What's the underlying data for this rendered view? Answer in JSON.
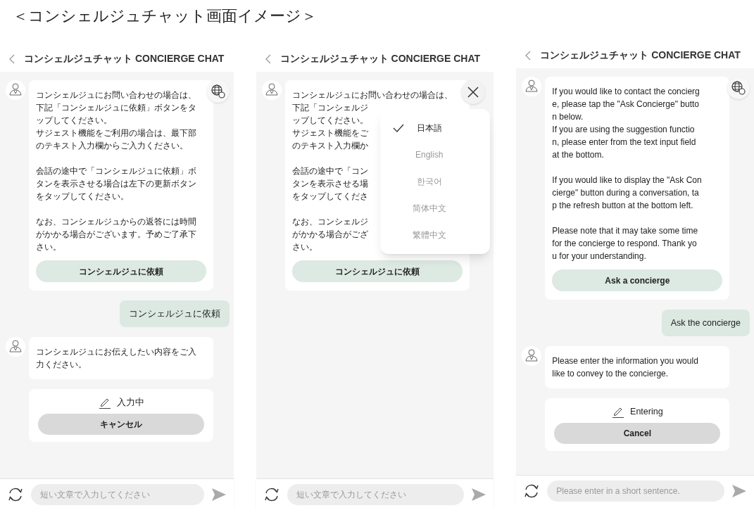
{
  "page_title": "＜コンシェルジュチャット画面イメージ＞",
  "screens": [
    {
      "header": {
        "title": "コンシェルジュチャット CONCIERGE CHAT"
      },
      "corner_button": {
        "kind": "language"
      },
      "messages": [
        {
          "kind": "bot",
          "paragraphs": [
            [
              "コンシェルジュにお問い合わせの場合は、",
              "下記「コンシェルジュに依頼」ボタンをタ",
              "ップしてください。",
              "サジェスト機能をご利用の場合は、最下部",
              "のテキスト入力欄からご入力ください。"
            ],
            [
              "会話の途中で「コンシェルジュに依頼」ボ",
              "タンを表示させる場合は左下の更新ボタン",
              "をタップしてください。"
            ],
            [
              "なお、コンシェルジュからの返答には時間",
              "がかかる場合がございます。予めご了承下",
              "さい。"
            ]
          ],
          "button": "コンシェルジュに依頼"
        },
        {
          "kind": "user",
          "text": "コンシェルジュに依頼"
        },
        {
          "kind": "bot",
          "paragraphs": [
            [
              "コンシェルジュにお伝えしたい内容をご入",
              "力ください。"
            ]
          ]
        },
        {
          "kind": "status",
          "label": "入力中",
          "button": "キャンセル"
        }
      ],
      "input": {
        "placeholder": "短い文章で入力してください"
      }
    },
    {
      "header": {
        "title": "コンシェルジュチャット CONCIERGE CHAT"
      },
      "corner_button": {
        "kind": "close"
      },
      "language_menu": [
        {
          "label": "日本語",
          "selected": true
        },
        {
          "label": "English",
          "selected": false
        },
        {
          "label": "한국어",
          "selected": false
        },
        {
          "label": "简体中文",
          "selected": false
        },
        {
          "label": "繁體中文",
          "selected": false
        }
      ],
      "messages": [
        {
          "kind": "bot",
          "paragraphs": [
            [
              "コンシェルジュにお問い合わせの場合は、",
              "下記「コンシェルジ",
              "ップしてください。",
              "サジェスト機能をご",
              "のテキスト入力欄か"
            ],
            [
              "会話の途中で「コン",
              "タンを表示させる場",
              "をタップしてくださ"
            ],
            [
              "なお、コンシェルジ",
              "がかかる場合がござ",
              "さい。"
            ]
          ],
          "button": "コンシェルジュに依頼"
        }
      ],
      "input": {
        "placeholder": "短い文章で入力してください"
      }
    },
    {
      "header": {
        "title": "コンシェルジュチャット CONCIERGE CHAT"
      },
      "corner_button": {
        "kind": "language"
      },
      "messages": [
        {
          "kind": "bot",
          "paragraphs": [
            [
              "If you would like to contact the concierg",
              "e, please tap the \"Ask Concierge\" butto",
              "n below.",
              "If you are using the suggestion functio",
              "n, please enter from the text input field",
              "at the bottom."
            ],
            [
              "If you would like to display the \"Ask Con",
              "cierge\" button during a conversation, ta",
              "p the refresh button at the bottom left."
            ],
            [
              "Please note that it may take some time",
              "for the concierge to respond. Thank yo",
              "u for your understanding."
            ]
          ],
          "button": "Ask a concierge"
        },
        {
          "kind": "user",
          "text": "Ask the concierge"
        },
        {
          "kind": "bot",
          "paragraphs": [
            [
              "Please enter the information you would",
              "like to convey to the concierge."
            ]
          ]
        },
        {
          "kind": "status",
          "label": "Entering",
          "button": "Cancel"
        }
      ],
      "input": {
        "placeholder": "Please enter in a short sentence."
      }
    }
  ]
}
